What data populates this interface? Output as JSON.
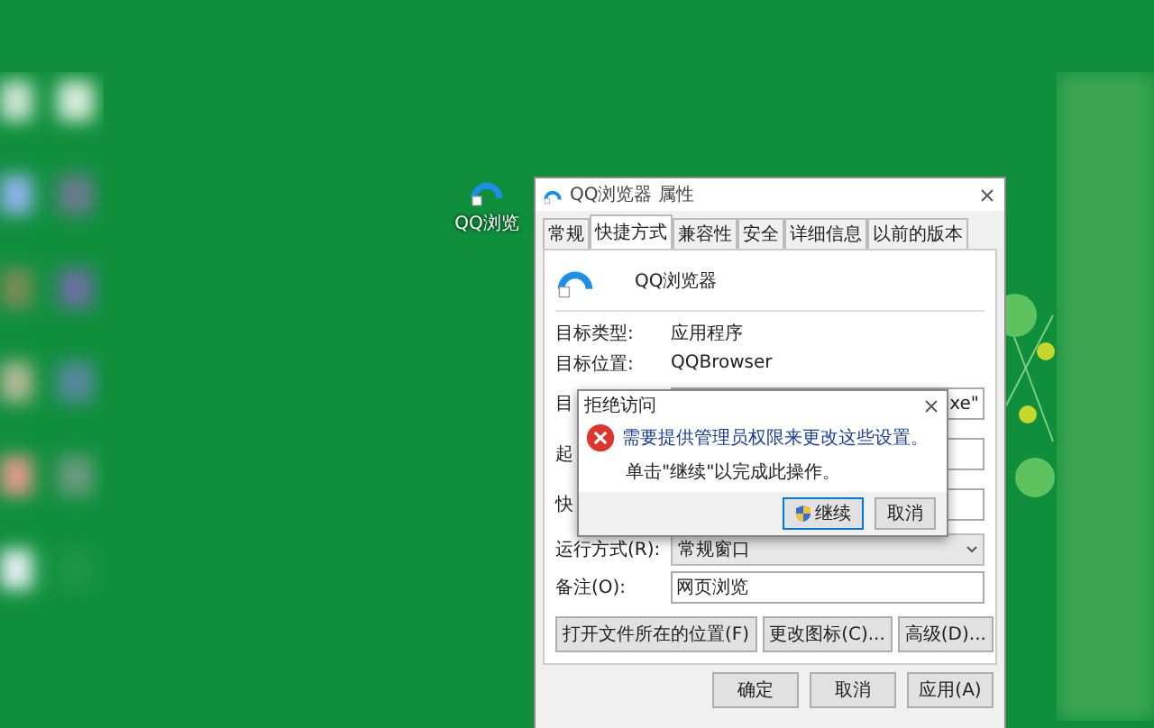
{
  "desktop_icon": {
    "label": "QQ浏览"
  },
  "properties_window": {
    "title": "QQ浏览器 属性",
    "tabs": [
      {
        "label": "常规",
        "selected": false
      },
      {
        "label": "快捷方式",
        "selected": true
      },
      {
        "label": "兼容性",
        "selected": false
      },
      {
        "label": "安全",
        "selected": false
      },
      {
        "label": "详细信息",
        "selected": false
      },
      {
        "label": "以前的版本",
        "selected": false
      }
    ],
    "app_name": "QQ浏览器",
    "info_rows": [
      {
        "label": "目标类型:",
        "value": "应用程序"
      },
      {
        "label": "目标位置:",
        "value": "QQBrowser"
      }
    ],
    "field_rows": [
      {
        "kind": "text",
        "label": "目",
        "value": "xe\""
      },
      {
        "kind": "text",
        "label": "起",
        "value": ""
      },
      {
        "kind": "text",
        "label": "快",
        "value": ""
      },
      {
        "kind": "select",
        "label": "运行方式(R):",
        "value": "常规窗口"
      },
      {
        "kind": "text",
        "label": "备注(O):",
        "value": "网页浏览"
      }
    ],
    "action_buttons": [
      "打开文件所在的位置(F)",
      "更改图标(C)...",
      "高级(D)..."
    ],
    "footer_buttons": [
      "确定",
      "取消",
      "应用(A)"
    ]
  },
  "alert_dialog": {
    "title": "拒绝访问",
    "message": "需要提供管理员权限来更改这些设置。",
    "detail": "单击\"继续\"以完成此操作。",
    "buttons": [
      {
        "label": "继续",
        "kind": "shield",
        "selected": true
      },
      {
        "label": "取消",
        "kind": "plain",
        "selected": false
      }
    ]
  }
}
